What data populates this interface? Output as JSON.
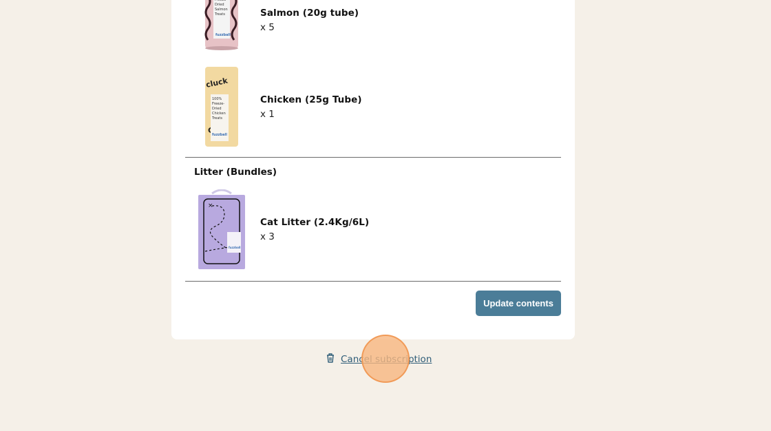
{
  "treats": {
    "items": [
      {
        "name": "Salmon (20g tube)",
        "qty": "x 5",
        "image": "salmon-tube-image"
      },
      {
        "name": "Chicken (25g Tube)",
        "qty": "x 1",
        "image": "chicken-tube-image"
      }
    ]
  },
  "litter": {
    "heading": "Litter (Bundles)",
    "items": [
      {
        "name": "Cat Litter (2.4Kg/6L)",
        "qty": "x 3",
        "image": "cat-litter-bag-image"
      }
    ]
  },
  "actions": {
    "update_label": "Update contents",
    "cancel_label": "Cancel subscription"
  },
  "colors": {
    "accent": "#4b7d98",
    "link": "#2f5d78",
    "background": "#f5f0e8"
  }
}
